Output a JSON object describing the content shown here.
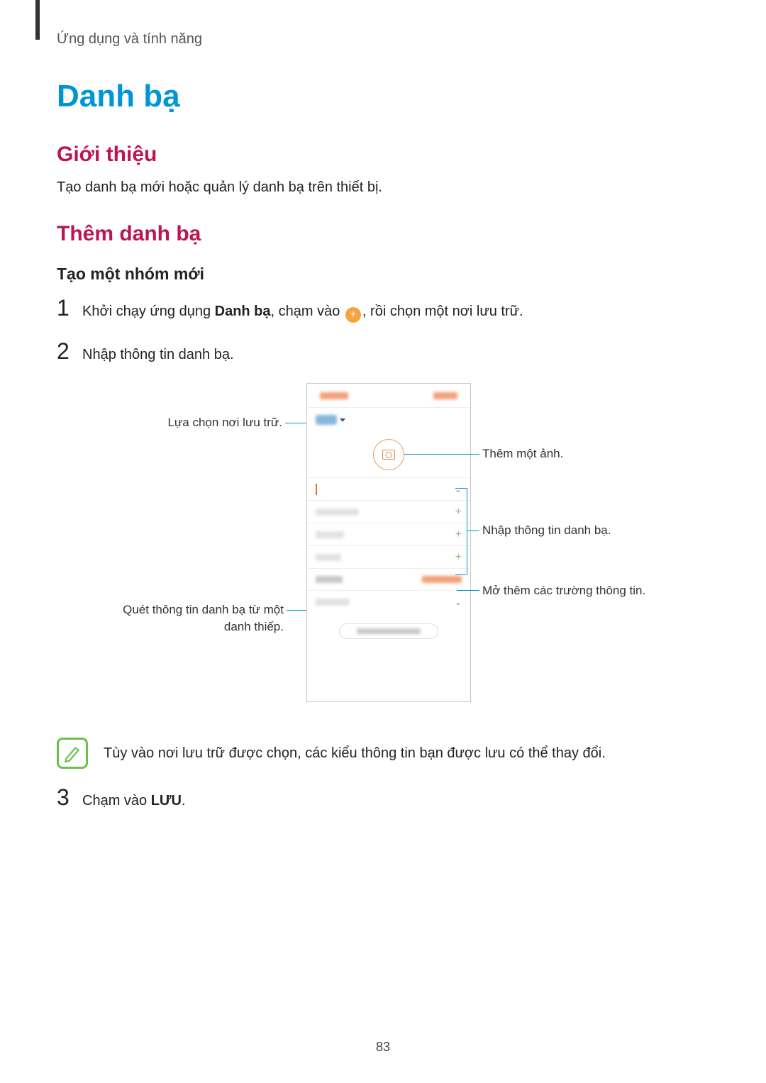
{
  "breadcrumb": "Ứng dụng và tính năng",
  "title": "Danh bạ",
  "section_intro_heading": "Giới thiệu",
  "section_intro_body": "Tạo danh bạ mới hoặc quản lý danh bạ trên thiết bị.",
  "section_add_heading": "Thêm danh bạ",
  "subsection_create_heading": "Tạo một nhóm mới",
  "step1_num": "1",
  "step1_pre": "Khởi chạy ứng dụng ",
  "step1_bold": "Danh bạ",
  "step1_mid": ", chạm vào ",
  "step1_after": ", rồi chọn một nơi lưu trữ.",
  "step2_num": "2",
  "step2_text": "Nhập thông tin danh bạ.",
  "callout_storage": "Lựa chọn nơi lưu trữ.",
  "callout_addimage": "Thêm một ảnh.",
  "callout_enterinfo": "Nhập thông tin danh bạ.",
  "callout_morefields": "Mở thêm các trường thông tin.",
  "callout_scan_l1": "Quét thông tin danh bạ từ một",
  "callout_scan_l2": "danh thiếp.",
  "note_text": "Tùy vào nơi lưu trữ được chọn, các kiểu thông tin bạn được lưu có thể thay đổi.",
  "step3_num": "3",
  "step3_pre": "Chạm vào ",
  "step3_bold": "LƯU",
  "step3_after": ".",
  "page_number": "83"
}
